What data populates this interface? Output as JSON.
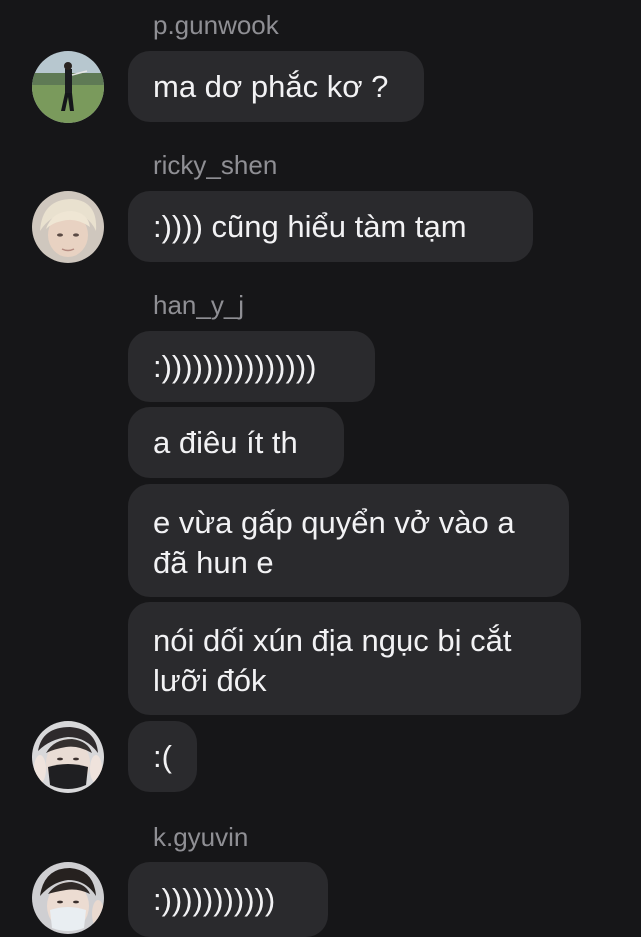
{
  "thread": {
    "groups": [
      {
        "username": "p.gunwook",
        "avatar_icon": "user-avatar-golfer",
        "messages": [
          "ma dơ phắc kơ ?"
        ]
      },
      {
        "username": "ricky_shen",
        "avatar_icon": "user-avatar-blond",
        "messages": [
          ":)))) cũng hiểu tàm tạm"
        ]
      },
      {
        "username": "han_y_j",
        "avatar_icon": "user-avatar-masked",
        "messages": [
          ":)))))))))))))))",
          "a điêu ít th",
          "e vừa gấp quyển vở vào a\nđã hun e",
          "nói dối xún địa ngục bị cắt\nlưỡi đók",
          ":("
        ]
      },
      {
        "username": "k.gyuvin",
        "avatar_icon": "user-avatar-masked-2",
        "messages": [
          ":)))))))))))"
        ]
      }
    ]
  },
  "colors": {
    "background": "#161618",
    "bubble": "#2a2a2d",
    "username": "#8f8f94",
    "text": "#f2f2f4"
  }
}
